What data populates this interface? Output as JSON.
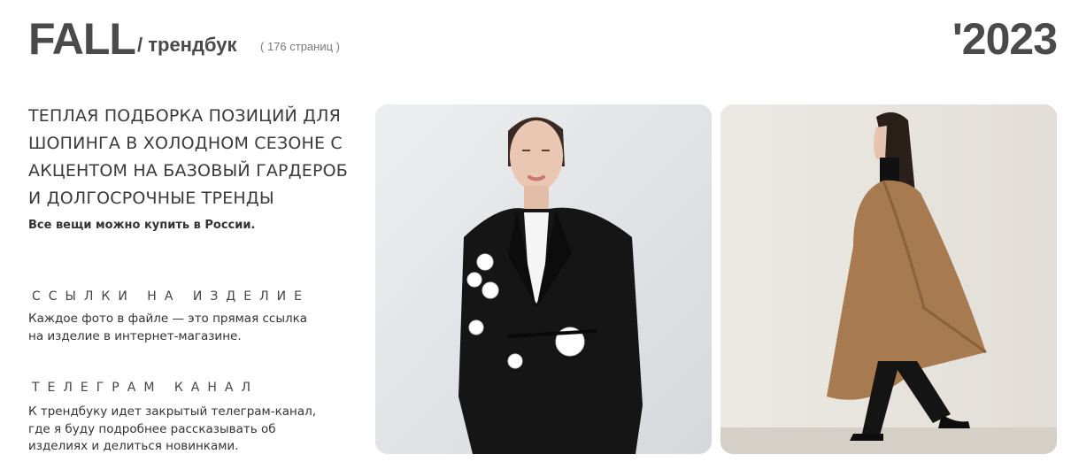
{
  "header": {
    "title": "FALL",
    "subtitle": "/ трендбук",
    "pages": "( 176 страниц )",
    "year": "'2023"
  },
  "intro": {
    "lead_lines": [
      "ТЕПЛАЯ ПОДБОРКА ПОЗИЦИЙ ДЛЯ",
      "ШОПИНГА В ХОЛОДНОМ СЕЗОНЕ С",
      "АКЦЕНТОМ НА БАЗОВЫЙ ГАРДЕРОБ",
      "И ДОЛГОСРОЧНЫЕ ТРЕНДЫ"
    ],
    "note": "Все вещи можно купить в России."
  },
  "links_section": {
    "heading": "ССЫЛКИ НА ИЗДЕЛИЕ",
    "text_lines": [
      "Каждое фото в файле — это прямая ссылка",
      "на изделие в интернет-магазине."
    ]
  },
  "telegram_section": {
    "heading": "ТЕЛЕГРАМ КАНАЛ",
    "text_lines": [
      "К трендбуку идет закрытый телеграм-канал,",
      "где я буду подробнее рассказывать об",
      "изделиях и делиться новинками."
    ]
  },
  "photos": [
    {
      "subject": "black-blazer-with-white-flowers"
    },
    {
      "subject": "camel-cape-coat"
    }
  ],
  "colors": {
    "text": "#3a3a3a",
    "photo1_bg": "#e3e4e6",
    "photo2_bg": "#ebe8e3",
    "blazer": "#141414",
    "cape": "#a77a50"
  }
}
